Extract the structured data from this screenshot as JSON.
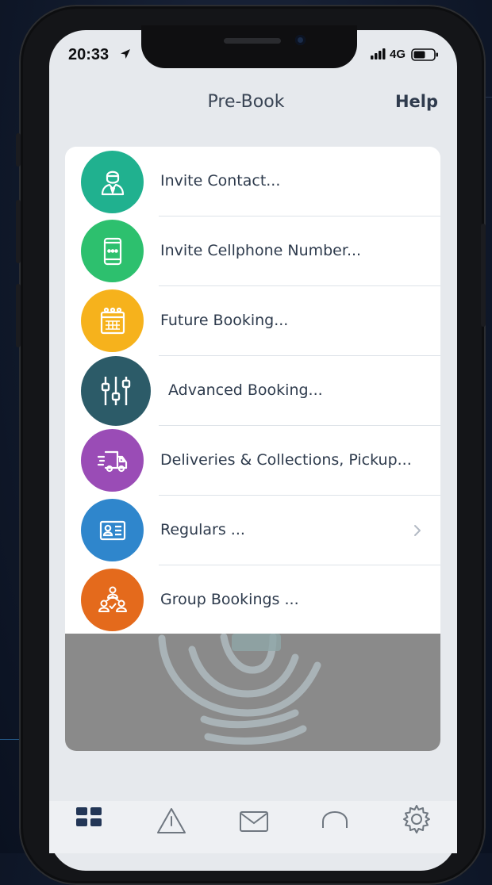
{
  "status": {
    "time": "20:33",
    "network": "4G"
  },
  "header": {
    "title": "Pre-Book",
    "help_label": "Help"
  },
  "menu": [
    {
      "label": "Invite Contact...",
      "icon": "contact-icon",
      "color": "#20b18f"
    },
    {
      "label": "Invite Cellphone Number...",
      "icon": "cellphone-icon",
      "color": "#2dc06e"
    },
    {
      "label": "Future Booking...",
      "icon": "calendar-icon",
      "color": "#f6b21c"
    },
    {
      "label": "Advanced Booking...",
      "icon": "sliders-icon",
      "color": "#2c5b68"
    },
    {
      "label": "Deliveries & Collections, Pickup...",
      "icon": "delivery-truck-icon",
      "color": "#9a4cb6"
    },
    {
      "label": "Regulars ...",
      "icon": "id-card-icon",
      "color": "#2f86cc"
    },
    {
      "label": "Group Bookings ...",
      "icon": "group-icon",
      "color": "#e46a1c"
    }
  ],
  "tabs": [
    {
      "icon": "dashboard-icon"
    },
    {
      "icon": "alert-icon"
    },
    {
      "icon": "mail-icon"
    },
    {
      "icon": "headset-icon"
    },
    {
      "icon": "gear-icon"
    }
  ]
}
